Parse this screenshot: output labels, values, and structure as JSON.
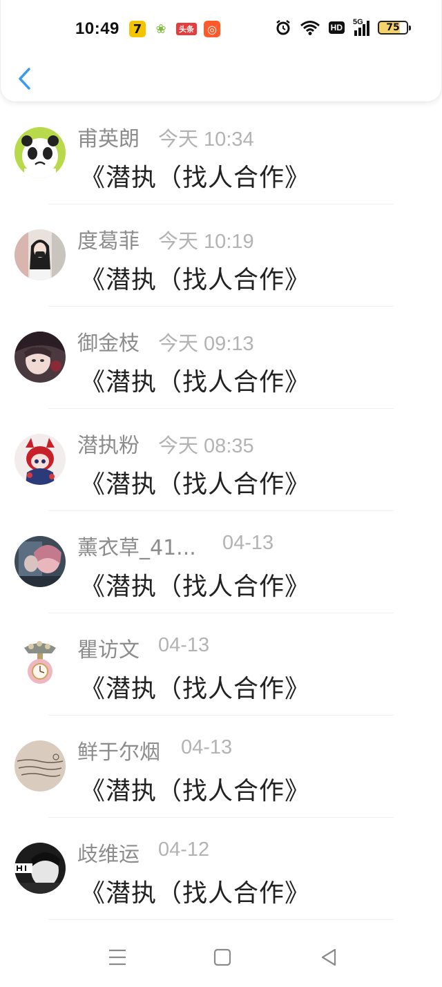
{
  "status_bar": {
    "time": "10:49",
    "notifications": [
      {
        "icon": "tencent-video-icon",
        "glyph": "7"
      },
      {
        "icon": "sprout-app-icon",
        "glyph": "❀"
      },
      {
        "icon": "toutiao-icon",
        "glyph": "头条"
      },
      {
        "icon": "kuaishou-icon",
        "glyph": "◎"
      }
    ],
    "hd_label": "HD",
    "network_label": "5G",
    "battery": "75",
    "battery_level": 0.75
  },
  "header": {
    "back_icon": "chevron-left-icon",
    "accent": "#3a9bf0"
  },
  "messages": [
    {
      "name": "甫英朗",
      "time": "今天 10:34",
      "text": "《潜执（找人合作》"
    },
    {
      "name": "度葛菲",
      "time": "今天 10:19",
      "text": "《潜执（找人合作》"
    },
    {
      "name": "御金枝",
      "time": "今天 09:13",
      "text": "《潜执（找人合作》"
    },
    {
      "name": "潜执粉",
      "time": "今天 08:35",
      "text": "《潜执（找人合作》"
    },
    {
      "name": "薰衣草_41...",
      "time": "04-13",
      "text": "《潜执（找人合作》"
    },
    {
      "name": "瞿访文",
      "time": "04-13",
      "text": "《潜执（找人合作》"
    },
    {
      "name": "鲜于尔烟",
      "time": "04-13",
      "text": "《潜执（找人合作》"
    },
    {
      "name": "歧维运",
      "time": "04-12",
      "text": "《潜执（找人合作》"
    }
  ],
  "navbar": {
    "menu_icon": "menu-icon",
    "home_icon": "home-square-icon",
    "back_icon": "back-triangle-icon"
  }
}
